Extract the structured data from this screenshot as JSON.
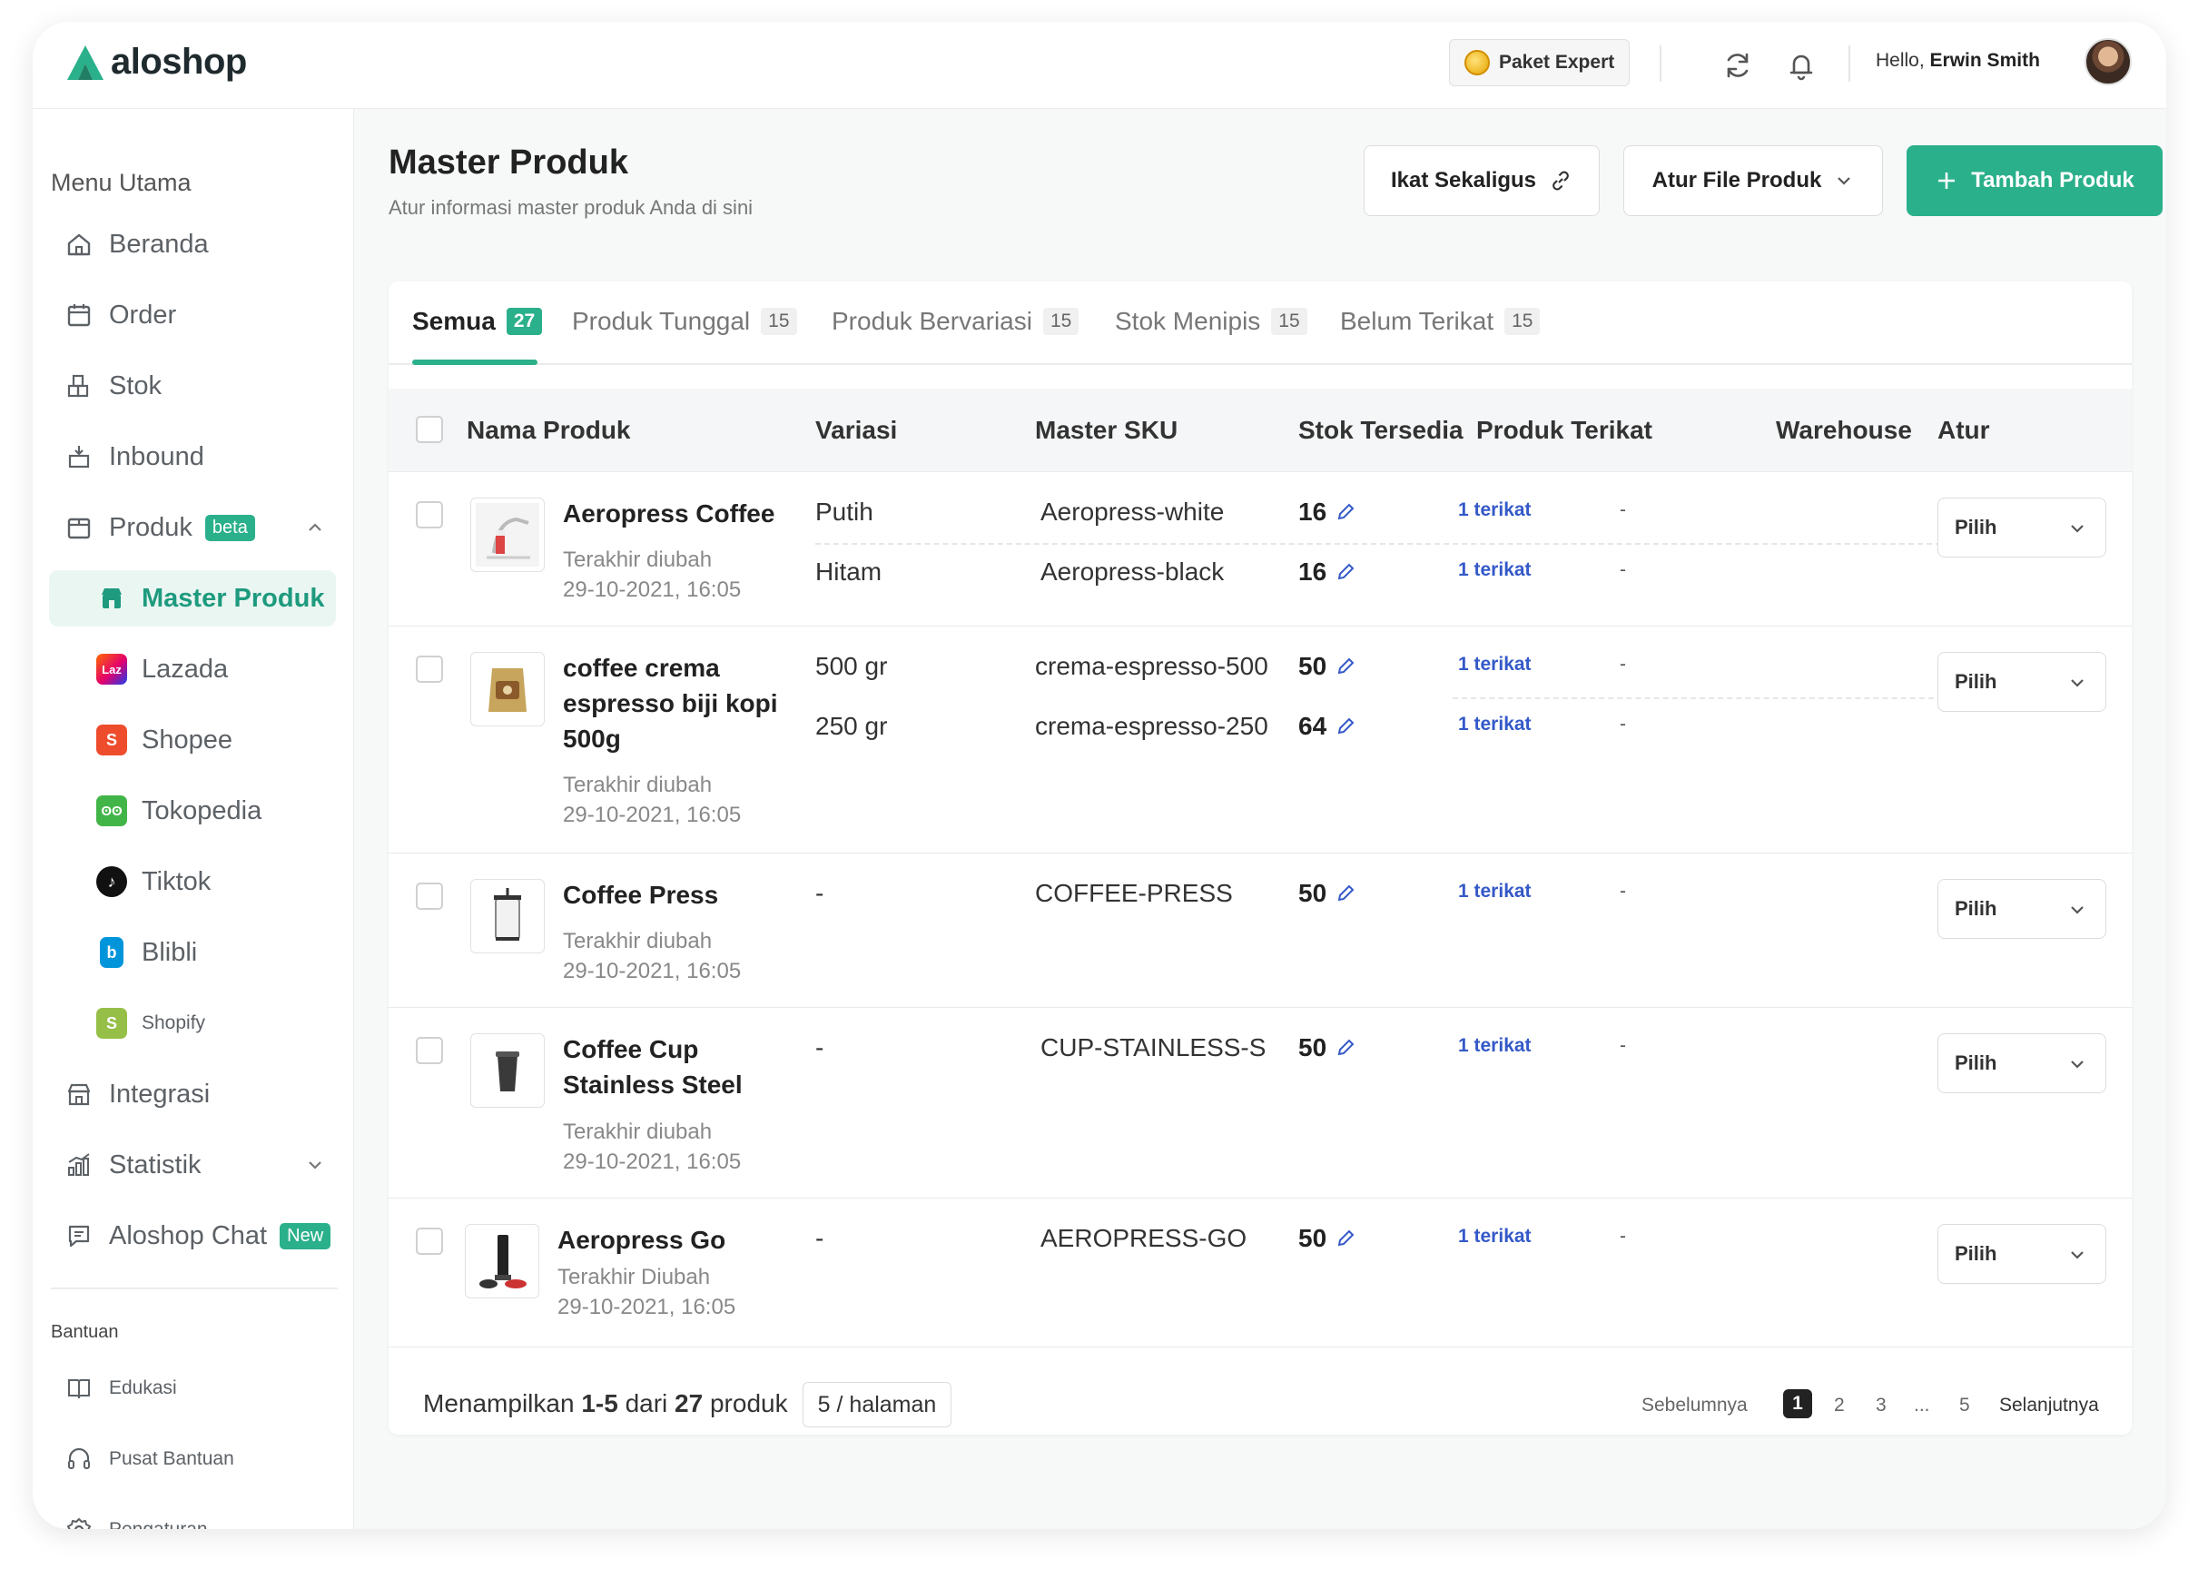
{
  "header": {
    "logo_text": "aloshop",
    "plan_label": "Paket Expert",
    "greeting": "Hello,",
    "user_name": "Erwin Smith"
  },
  "sidebar": {
    "section_main": "Menu Utama",
    "items": [
      {
        "label": "Beranda",
        "icon": "home-icon"
      },
      {
        "label": "Order",
        "icon": "calendar-icon"
      },
      {
        "label": "Stok",
        "icon": "boxes-icon"
      },
      {
        "label": "Inbound",
        "icon": "inbound-icon"
      },
      {
        "label": "Produk",
        "icon": "product-box-icon",
        "badge": "beta"
      },
      {
        "label": "Master Produk",
        "icon": "store-icon"
      },
      {
        "label": "Lazada",
        "icon": "lazada-icon"
      },
      {
        "label": "Shopee",
        "icon": "shopee-icon"
      },
      {
        "label": "Tokopedia",
        "icon": "tokopedia-icon"
      },
      {
        "label": "Tiktok",
        "icon": "tiktok-icon"
      },
      {
        "label": "Blibli",
        "icon": "blibli-icon"
      },
      {
        "label": "Shopify",
        "icon": "shopify-icon"
      },
      {
        "label": "Integrasi",
        "icon": "integration-icon"
      },
      {
        "label": "Statistik",
        "icon": "chart-icon"
      },
      {
        "label": "Aloshop Chat",
        "icon": "chat-icon",
        "badge": "New"
      }
    ],
    "section_help": "Bantuan",
    "help_items": [
      {
        "label": "Edukasi",
        "icon": "book-icon"
      },
      {
        "label": "Pusat Bantuan",
        "icon": "headset-icon"
      },
      {
        "label": "Pengaturan",
        "icon": "gear-icon"
      }
    ]
  },
  "page": {
    "title": "Master Produk",
    "subtitle": "Atur informasi master produk Anda di sini",
    "btn_bind": "Ikat Sekaligus",
    "btn_file": "Atur File Produk",
    "btn_add": "Tambah Produk"
  },
  "tabs": [
    {
      "label": "Semua",
      "count": "27"
    },
    {
      "label": "Produk Tunggal",
      "count": "15"
    },
    {
      "label": "Produk Bervariasi",
      "count": "15"
    },
    {
      "label": "Stok Menipis",
      "count": "15"
    },
    {
      "label": "Belum Terikat",
      "count": "15"
    }
  ],
  "table": {
    "headers": [
      "Nama Produk",
      "Variasi",
      "Master SKU",
      "Stok Tersedia",
      "Produk Terikat",
      "Warehouse",
      "Atur"
    ],
    "action_label": "Pilih",
    "rows": [
      {
        "name": "Aeropress Coffee",
        "updated_label": "Terakhir diubah",
        "updated_at": "29-10-2021, 16:05",
        "variants": [
          {
            "variation": "Putih",
            "sku": "Aeropress-white",
            "stock": "16",
            "linked": "1 terikat",
            "warehouse": "-"
          },
          {
            "variation": "Hitam",
            "sku": "Aeropress-black",
            "stock": "16",
            "linked": "1 terikat",
            "warehouse": "-"
          }
        ]
      },
      {
        "name": "coffee crema espresso biji kopi 500g",
        "updated_label": "Terakhir diubah",
        "updated_at": "29-10-2021, 16:05",
        "variants": [
          {
            "variation": "500 gr",
            "sku": "crema-espresso-500",
            "stock": "50",
            "linked": "1 terikat",
            "warehouse": "-"
          },
          {
            "variation": "250 gr",
            "sku": "crema-espresso-250",
            "stock": "64",
            "linked": "1 terikat",
            "warehouse": "-"
          }
        ]
      },
      {
        "name": "Coffee Press",
        "updated_label": "Terakhir diubah",
        "updated_at": "29-10-2021, 16:05",
        "variants": [
          {
            "variation": "-",
            "sku": "COFFEE-PRESS",
            "stock": "50",
            "linked": "1 terikat",
            "warehouse": "-"
          }
        ]
      },
      {
        "name": "Coffee Cup Stainless Steel",
        "updated_label": "Terakhir diubah",
        "updated_at": "29-10-2021, 16:05",
        "variants": [
          {
            "variation": "-",
            "sku": "CUP-STAINLESS-S",
            "stock": "50",
            "linked": "1 terikat",
            "warehouse": "-"
          }
        ]
      },
      {
        "name": "Aeropress Go",
        "updated_label": "Terakhir Diubah",
        "updated_at": "29-10-2021, 16:05",
        "variants": [
          {
            "variation": "-",
            "sku": "AEROPRESS-GO",
            "stock": "50",
            "linked": "1 terikat",
            "warehouse": "-"
          }
        ]
      }
    ]
  },
  "pagination": {
    "showing_prefix": "Menampilkan",
    "range": "1-5",
    "of": "dari",
    "total": "27",
    "unit": "produk",
    "per_page": "5 / halaman",
    "prev": "Sebelumnya",
    "pages": [
      "1",
      "2",
      "3",
      "...",
      "5"
    ],
    "current": "1",
    "next": "Selanjutnya"
  },
  "colors": {
    "accent": "#2ab08b",
    "link": "#3459c8",
    "badge_beta": "#2ab08b",
    "badge_new": "#2ab08b"
  }
}
